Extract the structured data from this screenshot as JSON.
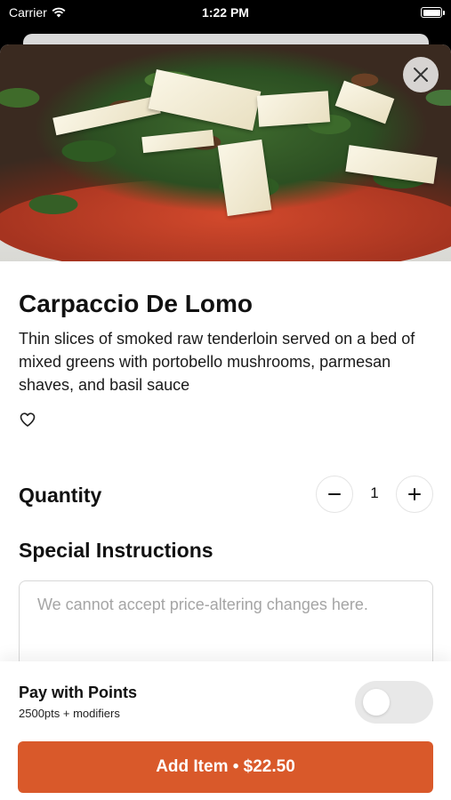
{
  "status_bar": {
    "carrier": "Carrier",
    "time": "1:22 PM",
    "icons": [
      "wifi-icon",
      "battery-icon"
    ]
  },
  "item": {
    "title": "Carpaccio De Lomo",
    "description": "Thin slices of smoked raw tenderloin served on a bed of mixed greens with portobello mushrooms, parmesan shaves, and basil sauce",
    "favorite_icon": "heart-outline-icon"
  },
  "quantity": {
    "label": "Quantity",
    "value": "1",
    "decrement_icon": "minus-icon",
    "increment_icon": "plus-icon"
  },
  "special_instructions": {
    "label": "Special Instructions",
    "placeholder": "We cannot accept price-altering changes here.",
    "value": ""
  },
  "points": {
    "title": "Pay with Points",
    "subtitle": "2500pts + modifiers",
    "toggle_on": false
  },
  "add_button": {
    "label": "Add Item • $22.50"
  },
  "colors": {
    "accent": "#d9592a",
    "toggle_off": "#e8e8e8"
  },
  "close_icon": "close-icon"
}
